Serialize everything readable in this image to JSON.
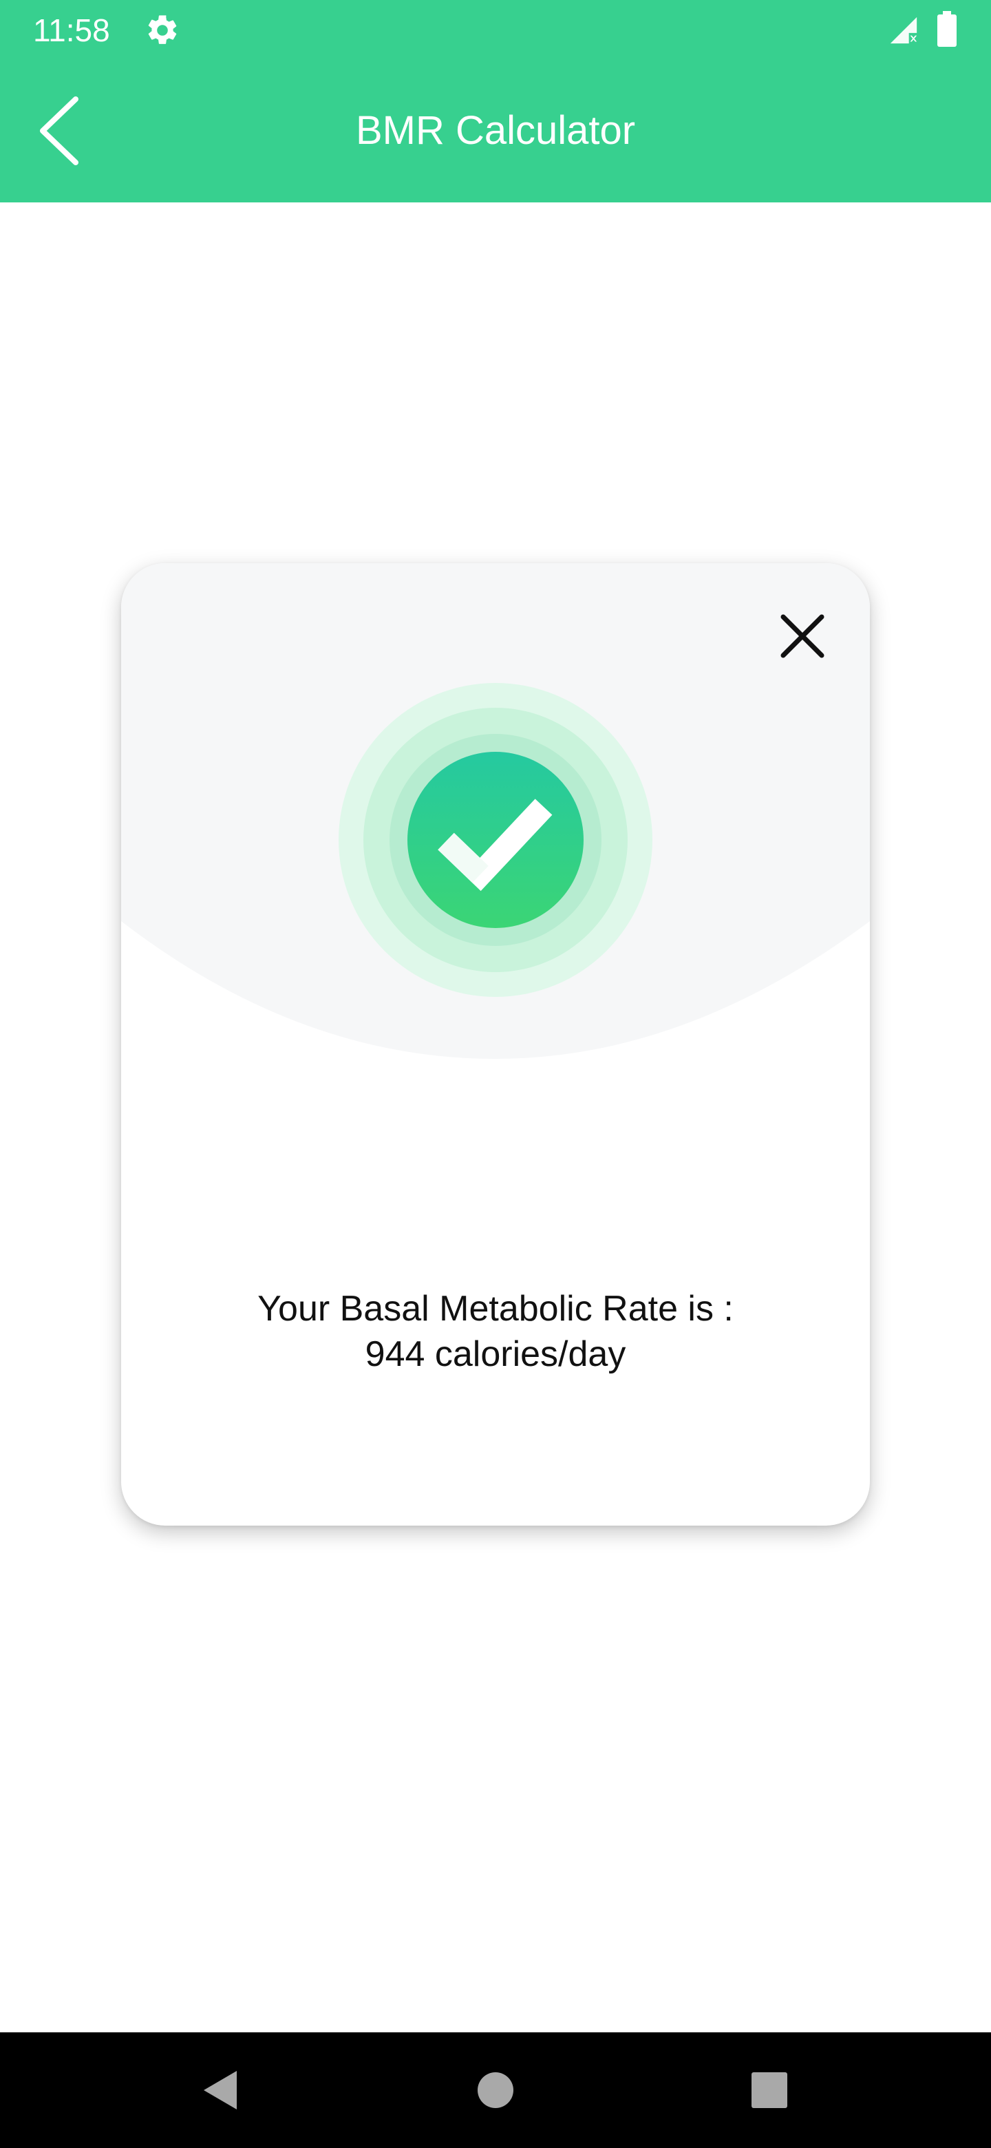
{
  "status_bar": {
    "time": "11:58",
    "icons": [
      "gear-icon",
      "signal-icon",
      "battery-icon"
    ]
  },
  "app_bar": {
    "title": "BMR Calculator",
    "back_icon": "chevron-left-icon"
  },
  "dialog": {
    "close_icon": "close-icon",
    "badge_icon": "checkmark-icon",
    "result_line1": "Your Basal Metabolic Rate is :",
    "result_line2": "944 calories/day"
  },
  "nav_bar": {
    "items": [
      "nav-back-icon",
      "nav-home-icon",
      "nav-recents-icon"
    ]
  },
  "colors": {
    "accent": "#37d08f",
    "badge_gradient_top": "#25c9a0",
    "badge_gradient_bottom": "#3bd575",
    "hero_bg": "#f6f7f8"
  }
}
